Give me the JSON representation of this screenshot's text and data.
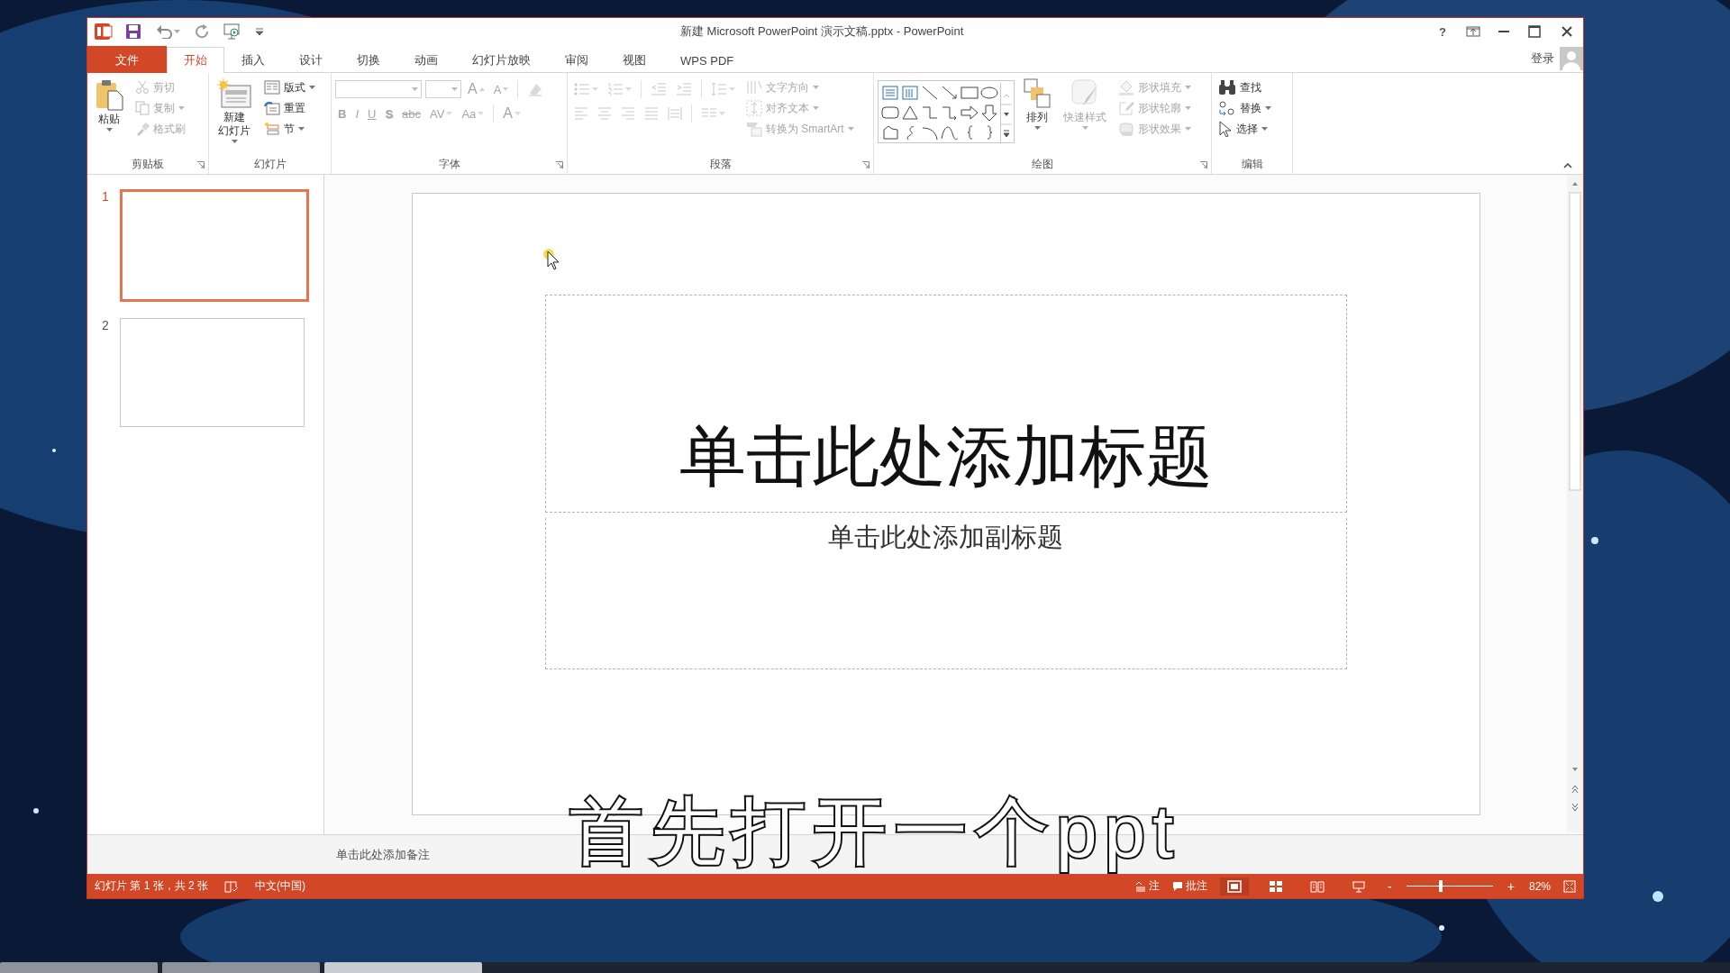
{
  "window": {
    "title": "新建 Microsoft PowerPoint 演示文稿.pptx - PowerPoint",
    "help": "?"
  },
  "tabs": [
    {
      "label": "文件",
      "kind": "file",
      "selected": false
    },
    {
      "label": "开始",
      "kind": "tab",
      "selected": true
    },
    {
      "label": "插入",
      "kind": "tab",
      "selected": false
    },
    {
      "label": "设计",
      "kind": "tab",
      "selected": false
    },
    {
      "label": "切换",
      "kind": "tab",
      "selected": false
    },
    {
      "label": "动画",
      "kind": "tab",
      "selected": false
    },
    {
      "label": "幻灯片放映",
      "kind": "tab",
      "selected": false
    },
    {
      "label": "审阅",
      "kind": "tab",
      "selected": false
    },
    {
      "label": "视图",
      "kind": "tab",
      "selected": false
    },
    {
      "label": "WPS PDF",
      "kind": "tab",
      "selected": false
    }
  ],
  "account": {
    "sign_in": "登录"
  },
  "ribbon": [
    {
      "kind": "clipboard",
      "label": "剪贴板",
      "big": {
        "lines": [
          "粘贴"
        ],
        "disabled": false
      },
      "items": [
        {
          "label": "剪切",
          "disabled": true
        },
        {
          "label": "复制",
          "disabled": true
        },
        {
          "label": "格式刷",
          "disabled": true
        }
      ]
    },
    {
      "kind": "slides",
      "label": "幻灯片",
      "big": {
        "lines": [
          "新建",
          "幻灯片"
        ],
        "disabled": false
      },
      "items": [
        {
          "label": "版式",
          "disabled": false
        },
        {
          "label": "重置",
          "disabled": false
        },
        {
          "label": "节",
          "disabled": false
        }
      ]
    },
    {
      "kind": "font",
      "label": "字体",
      "disabled": true,
      "size_buttons": [
        "A",
        "A"
      ],
      "format_buttons": [
        "B",
        "I",
        "U",
        "S",
        "abc",
        "AV",
        "Aa"
      ],
      "color_button": "A"
    },
    {
      "kind": "paragraph",
      "label": "段落",
      "disabled": true,
      "items": [
        {
          "label": "文字方向"
        },
        {
          "label": "对齐文本"
        },
        {
          "label": "转换为 SmartArt"
        }
      ]
    },
    {
      "kind": "drawing",
      "label": "绘图",
      "big": {
        "lines": [
          "排列"
        ],
        "disabled": false
      },
      "quick_styles": {
        "lines": [
          "快速样式"
        ],
        "disabled": true
      },
      "items": [
        {
          "label": "形状填充",
          "disabled": true
        },
        {
          "label": "形状轮廓",
          "disabled": true
        },
        {
          "label": "形状效果",
          "disabled": true
        }
      ]
    },
    {
      "kind": "editing",
      "label": "编辑",
      "items": [
        {
          "label": "查找",
          "disabled": false
        },
        {
          "label": "替换",
          "disabled": false
        },
        {
          "label": "选择",
          "disabled": false
        }
      ]
    }
  ],
  "slides": [
    {
      "number": "1",
      "selected": true
    },
    {
      "number": "2",
      "selected": false
    }
  ],
  "slide": {
    "title_placeholder": "单击此处添加标题",
    "subtitle_placeholder": "单击此处添加副标题"
  },
  "notes": {
    "placeholder": "单击此处添加备注"
  },
  "status_bar": {
    "slide_info": "幻灯片 第 1 张，共 2 张",
    "language": "中文(中国)",
    "notes": "注",
    "comments": "批注",
    "views": [
      {
        "kind": "normal",
        "selected": true
      },
      {
        "kind": "sorter",
        "selected": false
      },
      {
        "kind": "reading",
        "selected": false
      },
      {
        "kind": "slideshow",
        "selected": false
      }
    ],
    "zoom_out": "-",
    "zoom_in": "+",
    "zoom": {
      "level": 0.4
    },
    "zoom_percent": "82%"
  },
  "caption": "首先打开一个ppt"
}
